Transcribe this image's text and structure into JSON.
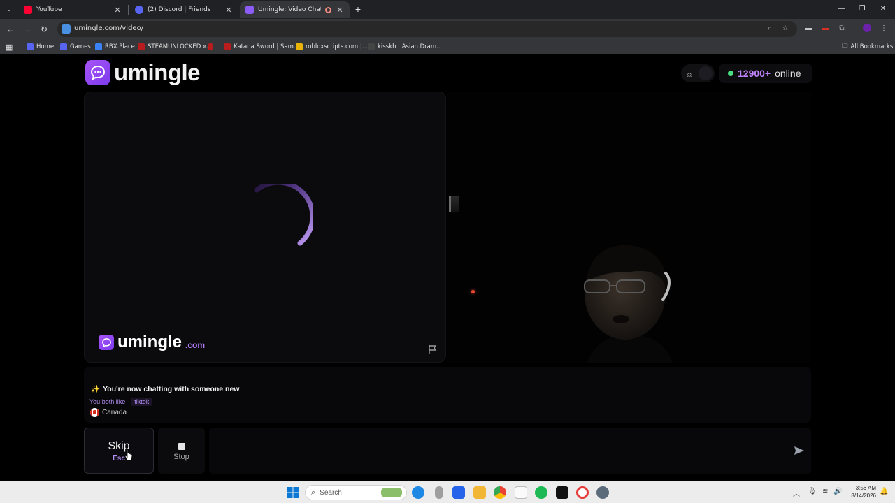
{
  "browser": {
    "tabs": [
      {
        "title": "YouTube",
        "color": "#ff0033"
      },
      {
        "title": "(2) Discord | Friends",
        "color": "#5865f2"
      },
      {
        "title": "Umingle: Video Chat with S",
        "color": "#8b5cf6"
      }
    ],
    "url": "umingle.com/video/",
    "bookmarks": [
      {
        "label": "Home",
        "color": "#5865f2"
      },
      {
        "label": "Games",
        "color": "#5865f2"
      },
      {
        "label": "RBX.Place",
        "color": "#3b82f6"
      },
      {
        "label": "STEAMUNLOCKED »...",
        "color": "#b91c1c"
      },
      {
        "label": "",
        "color": "#b91c1c"
      },
      {
        "label": "Katana Sword | Sam...",
        "color": "#b91c1c"
      },
      {
        "label": "robloxscripts.com |...",
        "color": "#eab308"
      },
      {
        "label": "kisskh | Asian Dram...",
        "color": "#444444"
      }
    ],
    "all_bookmarks": "All Bookmarks"
  },
  "app": {
    "logo": "umingle",
    "online_count": "12900+",
    "online_label": "online",
    "watermark_name": "umingle",
    "watermark_domain": ".com"
  },
  "chat": {
    "system_message": "You're now chatting with someone new",
    "system_icon": "✨",
    "both_like_label": "You both like",
    "interest": "tiktok",
    "country": "Canada",
    "input_placeholder": ""
  },
  "controls": {
    "skip_label": "Skip",
    "skip_key": "Esc",
    "stop_label": "Stop"
  },
  "taskbar": {
    "search_label": "Search",
    "time": "3:56 AM",
    "date": "8/14/2026"
  },
  "colors": {
    "accent": "#a855f7",
    "online_dot": "#4ade80"
  }
}
